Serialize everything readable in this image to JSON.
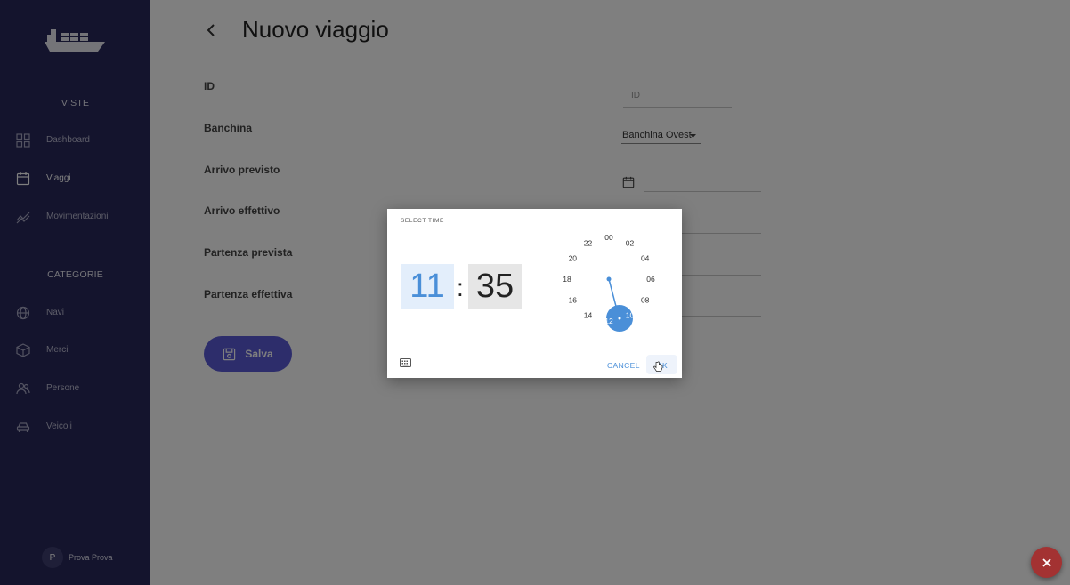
{
  "sidebar": {
    "section_views": "VISTE",
    "section_categories": "CATEGORIE",
    "views": [
      {
        "label": "Dashboard",
        "icon": "grid-icon"
      },
      {
        "label": "Viaggi",
        "icon": "calendar-icon",
        "active": true
      },
      {
        "label": "Movimentazioni",
        "icon": "trend-icon"
      }
    ],
    "categories": [
      {
        "label": "Navi",
        "icon": "globe-icon"
      },
      {
        "label": "Merci",
        "icon": "box-icon"
      },
      {
        "label": "Persone",
        "icon": "people-icon"
      },
      {
        "label": "Veicoli",
        "icon": "car-icon"
      }
    ],
    "user": {
      "initial": "P",
      "name": "Prova Prova"
    }
  },
  "main": {
    "title": "Nuovo viaggio",
    "fields": [
      {
        "label": "ID"
      },
      {
        "label": "Banchina"
      },
      {
        "label": "Arrivo previsto"
      },
      {
        "label": "Arrivo effettivo"
      },
      {
        "label": "Partenza prevista"
      },
      {
        "label": "Partenza effettiva"
      }
    ],
    "id_placeholder": "ID",
    "banchina_value": "Banchina Ovest",
    "save_label": "Salva"
  },
  "time_dialog": {
    "title": "SELECT TIME",
    "hour": "11",
    "separator": ":",
    "minute": "35",
    "clock_numbers": [
      "00",
      "02",
      "04",
      "06",
      "08",
      "10",
      "12",
      "14",
      "16",
      "18",
      "20",
      "22"
    ],
    "cancel_label": "CANCEL",
    "ok_label": "OK"
  },
  "colors": {
    "sidebar_bg": "#28285a",
    "accent": "#4a8fd8",
    "save_button": "#5a5ad6",
    "fab": "#a33232"
  }
}
